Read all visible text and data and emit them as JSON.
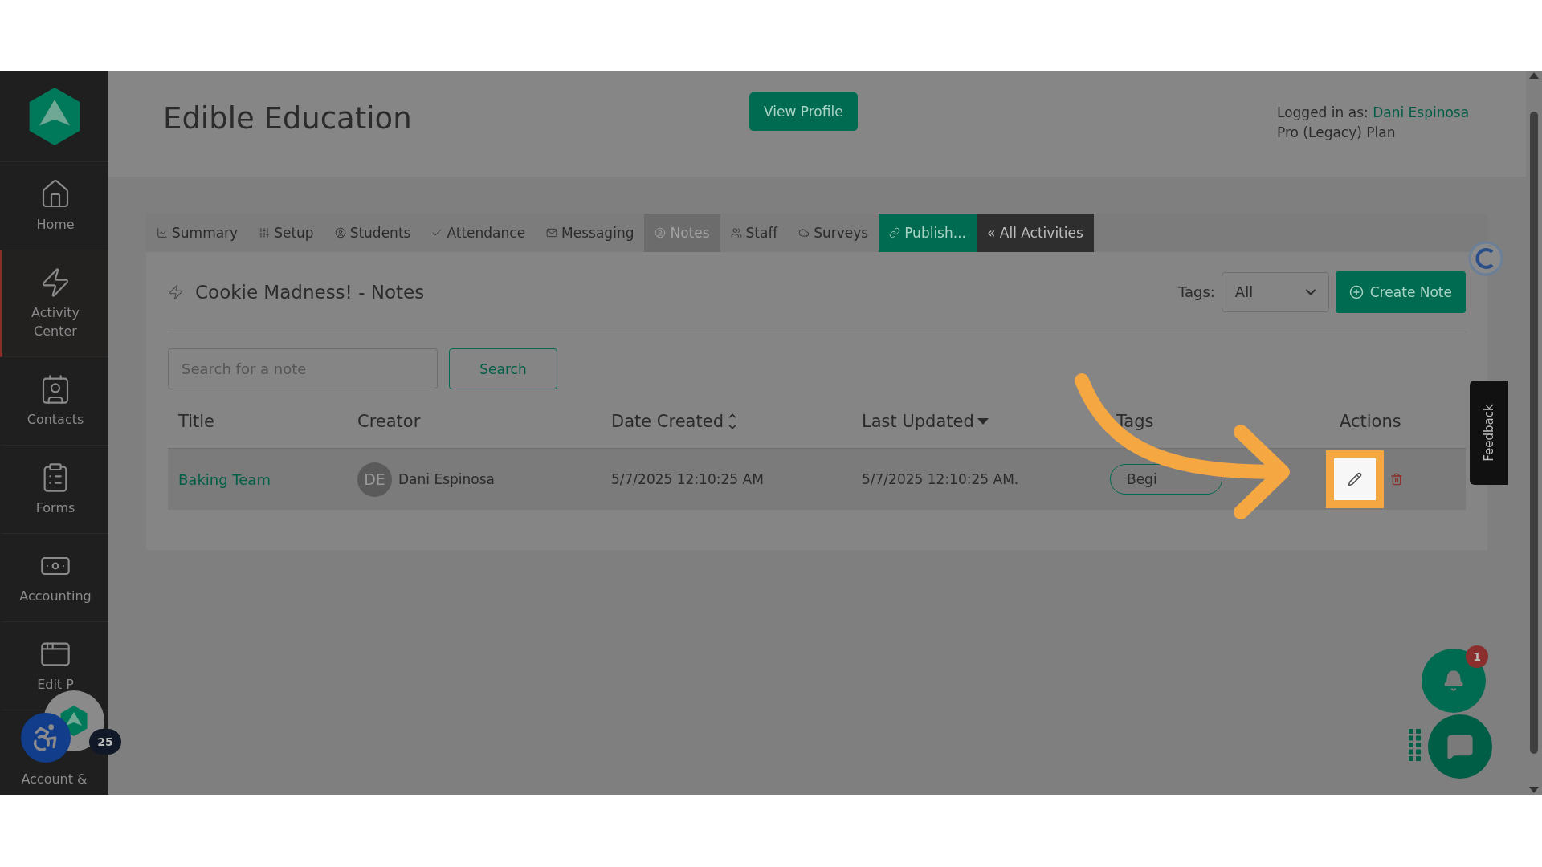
{
  "sidebar": {
    "items": [
      {
        "label": "Home",
        "selected": false
      },
      {
        "label": "Activity Center",
        "selected": true
      },
      {
        "label": "Contacts",
        "selected": false
      },
      {
        "label": "Forms",
        "selected": false
      },
      {
        "label": "Accounting",
        "selected": false
      },
      {
        "label": "Edit P",
        "selected": false
      },
      {
        "label": "Account &",
        "selected": false
      }
    ]
  },
  "header": {
    "title": "Edible Education",
    "view_profile": "View Profile",
    "logged_in_label": "Logged in as:",
    "user": "Dani Espinosa",
    "plan": "Pro (Legacy) Plan"
  },
  "tabs": [
    {
      "label": "Summary",
      "kind": "plain",
      "selected": false
    },
    {
      "label": "Setup",
      "kind": "plain",
      "selected": false
    },
    {
      "label": "Students",
      "kind": "plain",
      "selected": false
    },
    {
      "label": "Attendance",
      "kind": "plain",
      "selected": false
    },
    {
      "label": "Messaging",
      "kind": "plain",
      "selected": false
    },
    {
      "label": "Notes",
      "kind": "plain",
      "selected": true
    },
    {
      "label": "Staff",
      "kind": "plain",
      "selected": false
    },
    {
      "label": "Surveys",
      "kind": "plain",
      "selected": false
    },
    {
      "label": "Publish...",
      "kind": "accent",
      "selected": false
    },
    {
      "label": "« All Activities",
      "kind": "dark",
      "selected": false
    }
  ],
  "notes_panel": {
    "title": "Cookie Madness! - Notes",
    "tags_label": "Tags:",
    "tags_value": "All",
    "create_button": "Create Note",
    "search_placeholder": "Search for a note",
    "search_button": "Search"
  },
  "table": {
    "columns": [
      {
        "label": "Title"
      },
      {
        "label": "Creator"
      },
      {
        "label": "Date Created"
      },
      {
        "label": "Last Updated"
      },
      {
        "label": "Tags"
      },
      {
        "label": "Actions"
      }
    ],
    "rows": [
      {
        "title": "Baking Team",
        "initials": "DE",
        "creator": "Dani Espinosa",
        "created": "5/7/2025 12:10:25 AM",
        "updated": "5/7/2025 12:10:25 AM.",
        "tag": "Begi"
      }
    ]
  },
  "feedback": "Feedback",
  "accessibility_badge": "25",
  "notification_count": "1"
}
